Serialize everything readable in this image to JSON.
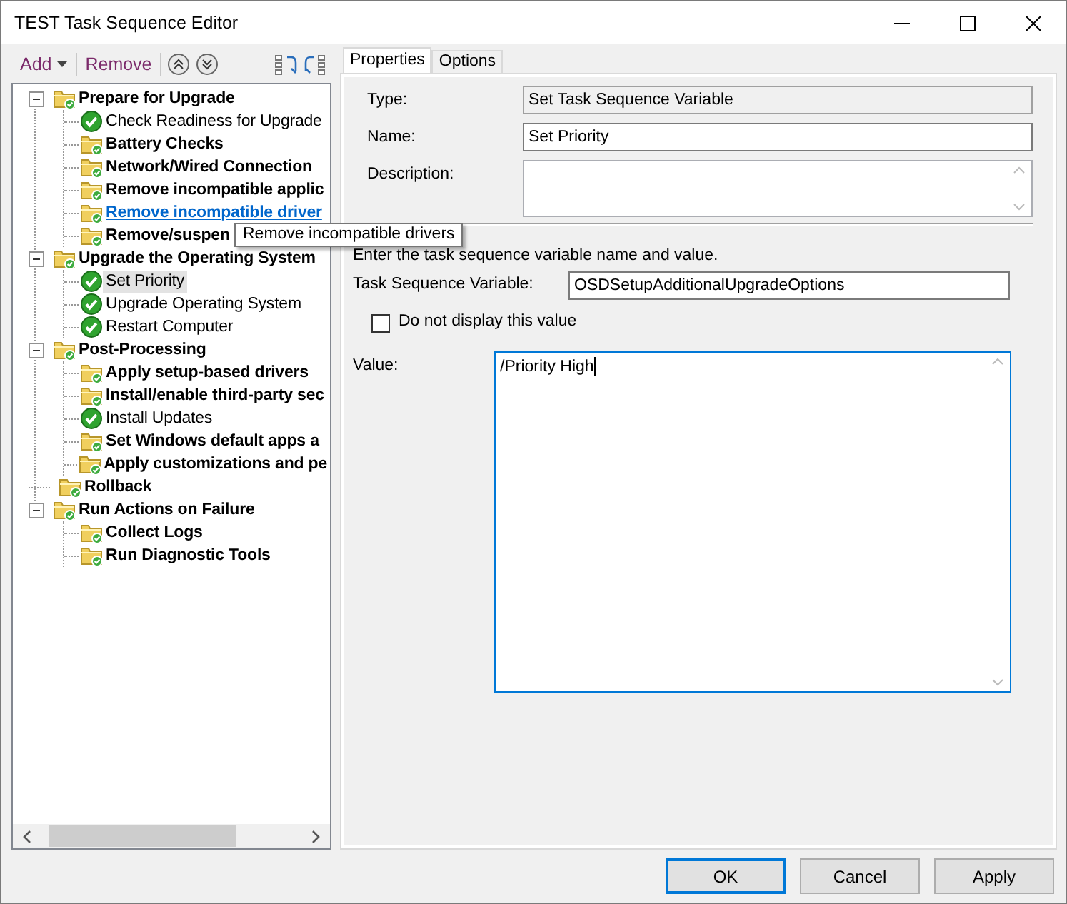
{
  "window": {
    "title": "TEST Task Sequence Editor"
  },
  "toolbar": {
    "add": "Add",
    "remove": "Remove"
  },
  "tree": [
    {
      "label": "Prepare for Upgrade",
      "kind": "group",
      "expanded": true,
      "selected": false,
      "hovered": false,
      "children": [
        {
          "label": "Check Readiness for Upgrade",
          "kind": "step",
          "selected": false,
          "hovered": false
        },
        {
          "label": "Battery Checks",
          "kind": "group",
          "selected": false,
          "hovered": false
        },
        {
          "label": "Network/Wired Connection",
          "kind": "group",
          "selected": false,
          "hovered": false
        },
        {
          "label": "Remove incompatible applic",
          "kind": "group",
          "selected": false,
          "hovered": false
        },
        {
          "label": "Remove incompatible driver",
          "kind": "group",
          "selected": false,
          "hovered": true
        },
        {
          "label": "Remove/suspen",
          "kind": "group",
          "selected": false,
          "hovered": false
        }
      ]
    },
    {
      "label": "Upgrade the Operating System",
      "kind": "group",
      "expanded": true,
      "selected": false,
      "hovered": false,
      "children": [
        {
          "label": "Set Priority",
          "kind": "step",
          "selected": true,
          "hovered": false
        },
        {
          "label": "Upgrade Operating System",
          "kind": "step",
          "selected": false,
          "hovered": false
        },
        {
          "label": "Restart Computer",
          "kind": "step",
          "selected": false,
          "hovered": false
        }
      ]
    },
    {
      "label": "Post-Processing",
      "kind": "group",
      "expanded": true,
      "selected": false,
      "hovered": false,
      "children": [
        {
          "label": "Apply setup-based drivers",
          "kind": "group",
          "selected": false,
          "hovered": false
        },
        {
          "label": "Install/enable third-party sec",
          "kind": "group",
          "selected": false,
          "hovered": false
        },
        {
          "label": "Install Updates",
          "kind": "step",
          "selected": false,
          "hovered": false
        },
        {
          "label": "Set Windows default apps a",
          "kind": "group",
          "selected": false,
          "hovered": false
        },
        {
          "label": "Apply customizations and pe",
          "kind": "group",
          "selected": false,
          "hovered": false
        }
      ]
    },
    {
      "label": "Rollback",
      "kind": "group",
      "selected": false,
      "hovered": false
    },
    {
      "label": "Run Actions on Failure",
      "kind": "group",
      "expanded": true,
      "selected": false,
      "hovered": false,
      "children": [
        {
          "label": "Collect Logs",
          "kind": "group",
          "selected": false,
          "hovered": false
        },
        {
          "label": "Run Diagnostic Tools",
          "kind": "group",
          "selected": false,
          "hovered": false
        }
      ]
    }
  ],
  "tooltip": "Remove incompatible drivers",
  "tabs": [
    {
      "label": "Properties",
      "selected": true
    },
    {
      "label": "Options",
      "selected": false
    }
  ],
  "properties": {
    "type_label": "Type:",
    "type_value": "Set Task Sequence Variable",
    "name_label": "Name:",
    "name_value": "Set Priority",
    "description_label": "Description:",
    "instruction": "Enter the task sequence variable name and value.",
    "variable_label": "Task Sequence Variable:",
    "variable_value": "OSDSetupAdditionalUpgradeOptions",
    "hide_value": {
      "label": "Do not display this value",
      "checked": false
    },
    "value_label": "Value:",
    "value_text": "/Priority High"
  },
  "buttons": [
    {
      "label": "OK",
      "default": true
    },
    {
      "label": "Cancel",
      "default": false
    },
    {
      "label": "Apply",
      "default": false
    }
  ]
}
